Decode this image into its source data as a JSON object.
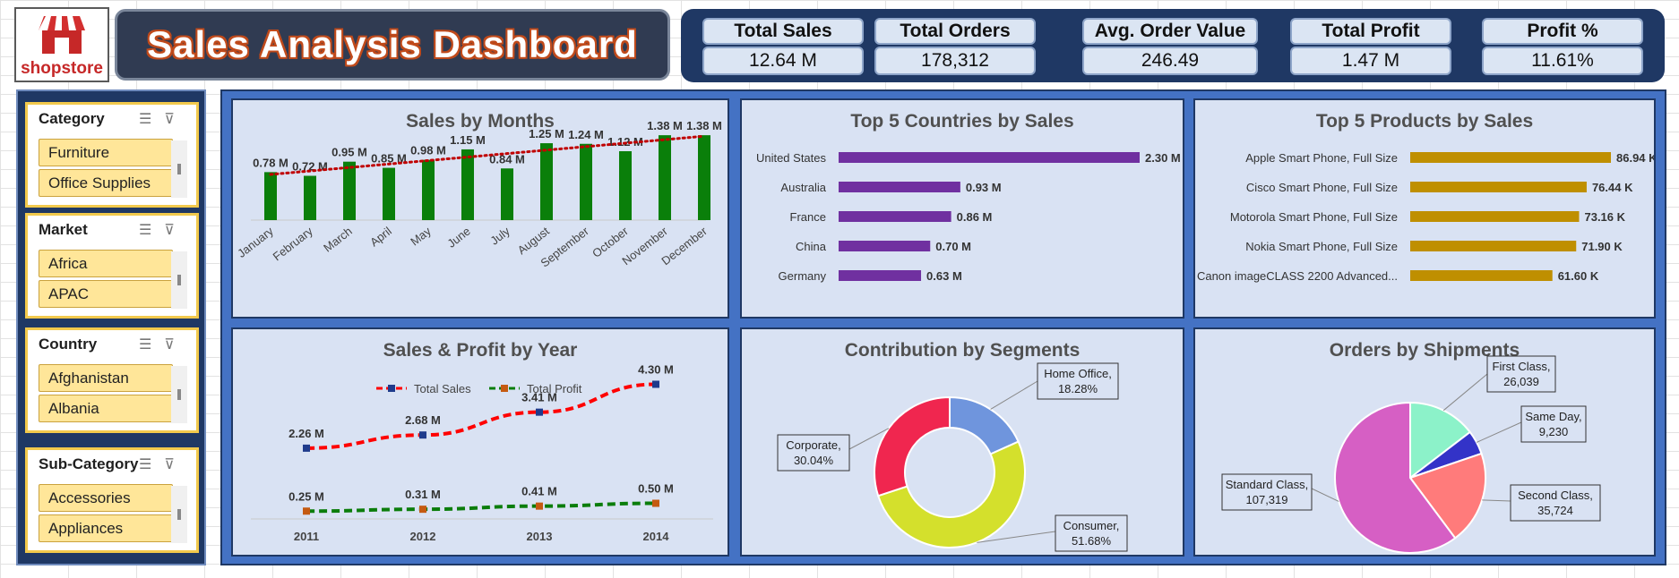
{
  "header": {
    "logo_text": "shopstore",
    "title": "Sales Analysis Dashboard",
    "kpis": [
      {
        "label": "Total Sales",
        "value": "12.64 M"
      },
      {
        "label": "Total Orders",
        "value": "178,312"
      },
      {
        "label": "Avg. Order Value",
        "value": "246.49"
      },
      {
        "label": "Total Profit",
        "value": "1.47 M"
      },
      {
        "label": "Profit %",
        "value": "11.61%"
      }
    ]
  },
  "slicers": [
    {
      "title": "Category",
      "items": [
        "Furniture",
        "Office Supplies"
      ]
    },
    {
      "title": "Market",
      "items": [
        "Africa",
        "APAC"
      ]
    },
    {
      "title": "Country",
      "items": [
        "Afghanistan",
        "Albania"
      ]
    },
    {
      "title": "Sub-Category",
      "items": [
        "Accessories",
        "Appliances"
      ]
    }
  ],
  "colors": {
    "month_bar": "#0a7f0a",
    "trend": "#c00000",
    "country_bar": "#7030a0",
    "product_bar": "#bf8f00",
    "sales_line": "#ff0000",
    "profit_line": "#0b7d0b"
  },
  "chart_data": [
    {
      "type": "bar",
      "title": "Sales by Months",
      "categories": [
        "January",
        "February",
        "March",
        "April",
        "May",
        "June",
        "July",
        "August",
        "September",
        "October",
        "November",
        "December"
      ],
      "values": [
        0.78,
        0.72,
        0.95,
        0.85,
        0.98,
        1.15,
        0.84,
        1.25,
        1.24,
        1.12,
        1.38,
        1.38
      ],
      "labels": [
        "0.78 M",
        "0.72 M",
        "0.95 M",
        "0.85 M",
        "0.98 M",
        "1.15 M",
        "0.84 M",
        "1.25 M",
        "1.24 M",
        "1.12 M",
        "1.38 M",
        "1.38 M"
      ],
      "trendline": true,
      "ylim": [
        0,
        1.6
      ]
    },
    {
      "type": "bar",
      "orientation": "horizontal",
      "title": "Top 5 Countries by Sales",
      "categories": [
        "United States",
        "Australia",
        "France",
        "China",
        "Germany"
      ],
      "values": [
        2.3,
        0.93,
        0.86,
        0.7,
        0.63
      ],
      "labels": [
        "2.30 M",
        "0.93 M",
        "0.86 M",
        "0.70 M",
        "0.63 M"
      ]
    },
    {
      "type": "bar",
      "orientation": "horizontal",
      "title": "Top 5 Products by Sales",
      "categories": [
        "Apple Smart Phone, Full Size",
        "Cisco Smart Phone, Full Size",
        "Motorola Smart Phone, Full Size",
        "Nokia Smart Phone, Full Size",
        "Canon imageCLASS 2200 Advanced..."
      ],
      "values": [
        86.94,
        76.44,
        73.16,
        71.9,
        61.6
      ],
      "labels": [
        "86.94 K",
        "76.44 K",
        "73.16 K",
        "71.90 K",
        "61.60 K"
      ]
    },
    {
      "type": "line",
      "title": "Sales & Profit by Year",
      "categories": [
        "2011",
        "2012",
        "2013",
        "2014"
      ],
      "series": [
        {
          "name": "Total Sales",
          "values": [
            2.26,
            2.68,
            3.41,
            4.3
          ],
          "labels": [
            "2.26 M",
            "2.68 M",
            "3.41 M",
            "4.30 M"
          ]
        },
        {
          "name": "Total Profit",
          "values": [
            0.25,
            0.31,
            0.41,
            0.5
          ],
          "labels": [
            "0.25 M",
            "0.31 M",
            "0.41 M",
            "0.50 M"
          ]
        }
      ],
      "ylim": [
        0,
        4.8
      ]
    },
    {
      "type": "pie",
      "donut": true,
      "title": "Contribution by Segments",
      "slices": [
        {
          "name": "Home Office,",
          "label": "18.28%",
          "value": 18.28,
          "color": "#6f95dd"
        },
        {
          "name": "Consumer,",
          "label": "51.68%",
          "value": 51.68,
          "color": "#d4e02c"
        },
        {
          "name": "Corporate,",
          "label": "30.04%",
          "value": 30.04,
          "color": "#f0264f"
        }
      ]
    },
    {
      "type": "pie",
      "title": "Orders by Shipments",
      "slices": [
        {
          "name": "First Class,",
          "label": "26,039",
          "value": 26039,
          "color": "#8cf2c9"
        },
        {
          "name": "Same Day,",
          "label": "9,230",
          "value": 9230,
          "color": "#3333c8"
        },
        {
          "name": "Second Class,",
          "label": "35,724",
          "value": 35724,
          "color": "#ff7b7b"
        },
        {
          "name": "Standard Class,",
          "label": "107,319",
          "value": 107319,
          "color": "#d65fc4"
        }
      ]
    }
  ]
}
